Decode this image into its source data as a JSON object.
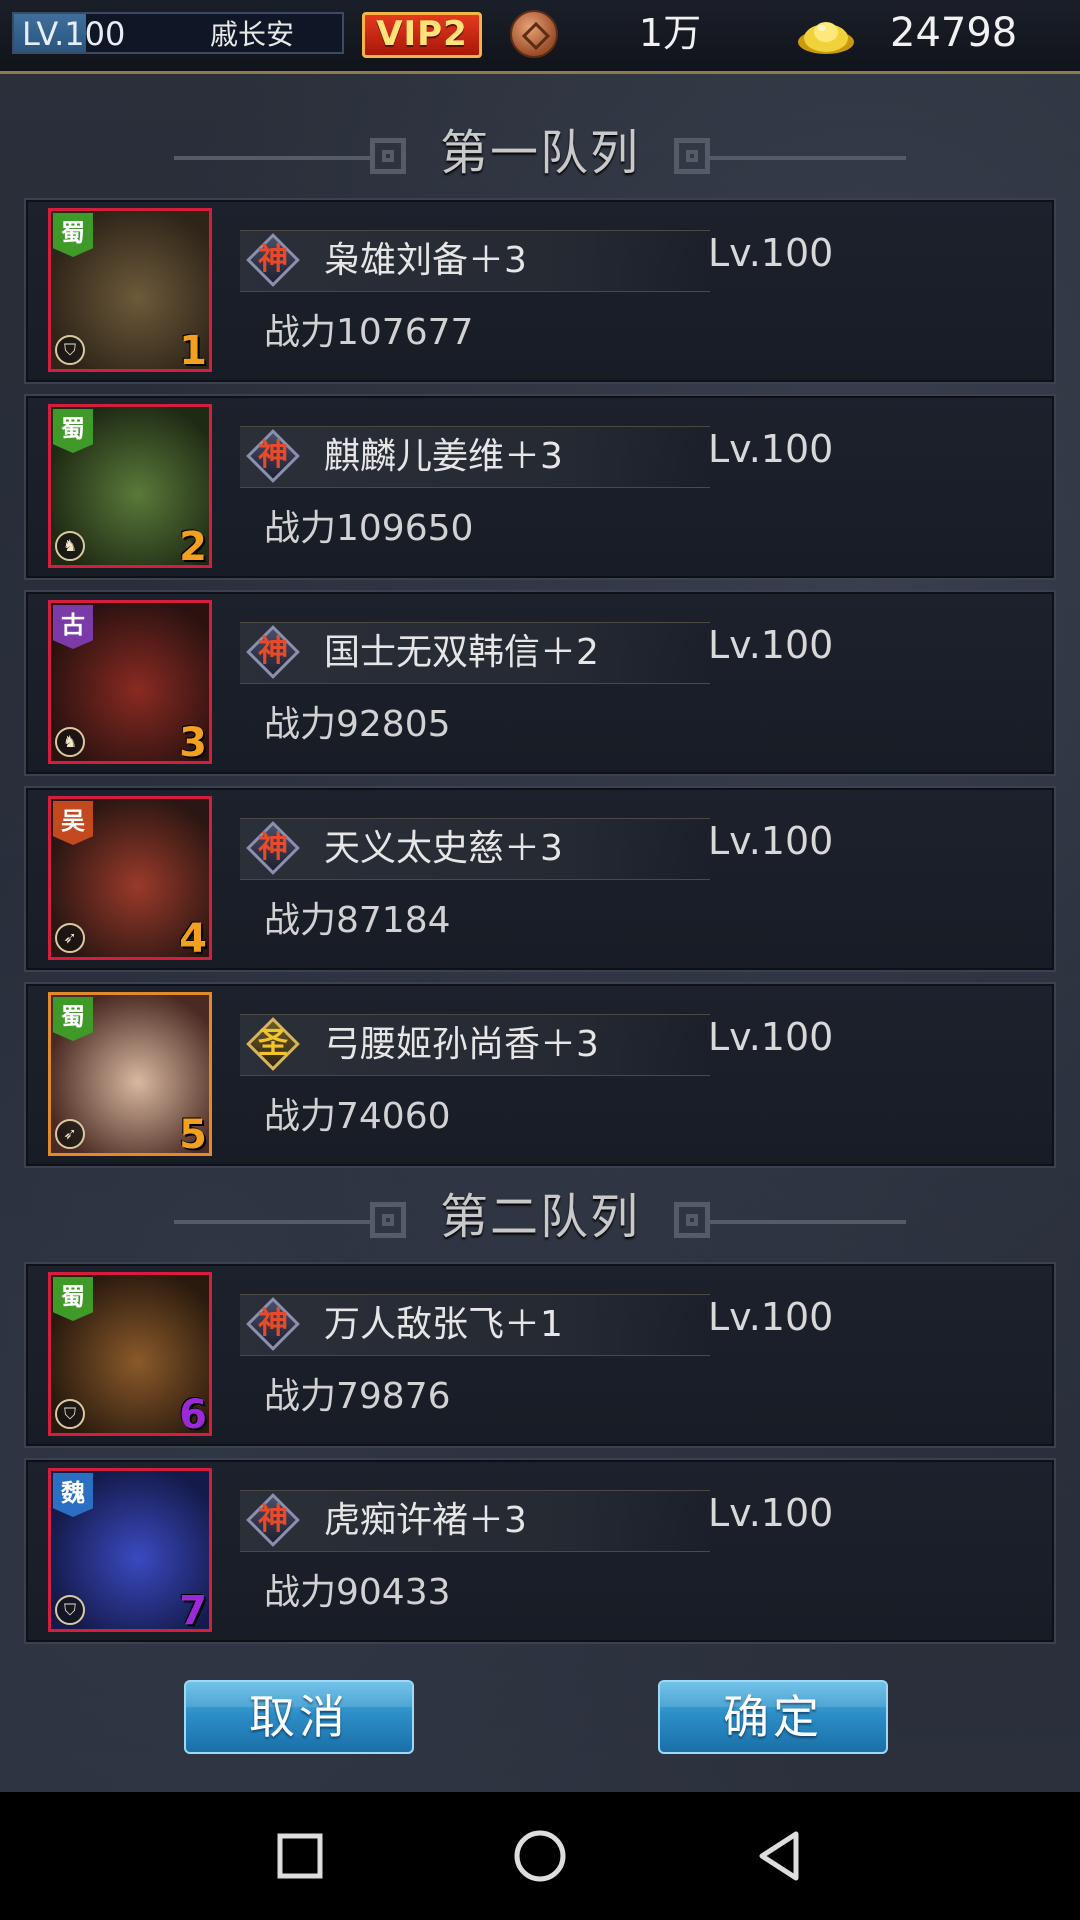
{
  "topbar": {
    "level_text": "LV.100",
    "level_progress": 0.22,
    "player_name": "戚长安",
    "vip_label": "VIP2",
    "coin_value": "1万",
    "gold_value": "24798"
  },
  "sections": [
    {
      "title": "第一队列"
    },
    {
      "title": "第二队列"
    }
  ],
  "heroes": [
    {
      "slot": "1",
      "name": "枭雄刘备＋3",
      "level": "Lv.100",
      "power": "战力107677",
      "faction": "蜀",
      "rank_glyph": "神",
      "faction_color": "#3f9a2a",
      "slot_color": "#f3a021"
    },
    {
      "slot": "2",
      "name": "麒麟儿姜维＋3",
      "level": "Lv.100",
      "power": "战力109650",
      "faction": "蜀",
      "rank_glyph": "神",
      "faction_color": "#3f9a2a",
      "slot_color": "#f3a021"
    },
    {
      "slot": "3",
      "name": "国士无双韩信＋2",
      "level": "Lv.100",
      "power": "战力92805",
      "faction": "古",
      "rank_glyph": "神",
      "faction_color": "#7b3aa8",
      "slot_color": "#f3a021"
    },
    {
      "slot": "4",
      "name": "天义太史慈＋3",
      "level": "Lv.100",
      "power": "战力87184",
      "faction": "吴",
      "rank_glyph": "神",
      "faction_color": "#c24a1e",
      "slot_color": "#f3a021"
    },
    {
      "slot": "5",
      "name": "弓腰姬孙尚香＋3",
      "level": "Lv.100",
      "power": "战力74060",
      "faction": "蜀",
      "rank_glyph": "圣",
      "faction_color": "#3f9a2a",
      "slot_color": "#f3a021"
    },
    {
      "slot": "6",
      "name": "万人敌张飞＋1",
      "level": "Lv.100",
      "power": "战力79876",
      "faction": "蜀",
      "rank_glyph": "神",
      "faction_color": "#3f9a2a",
      "slot_color": "#9a2ad8"
    },
    {
      "slot": "7",
      "name": "虎痴许褚＋3",
      "level": "Lv.100",
      "power": "战力90433",
      "faction": "魏",
      "rank_glyph": "神",
      "faction_color": "#2a6fc2",
      "slot_color": "#9a2ad8"
    }
  ],
  "buttons": {
    "cancel": "取消",
    "confirm": "确定"
  }
}
